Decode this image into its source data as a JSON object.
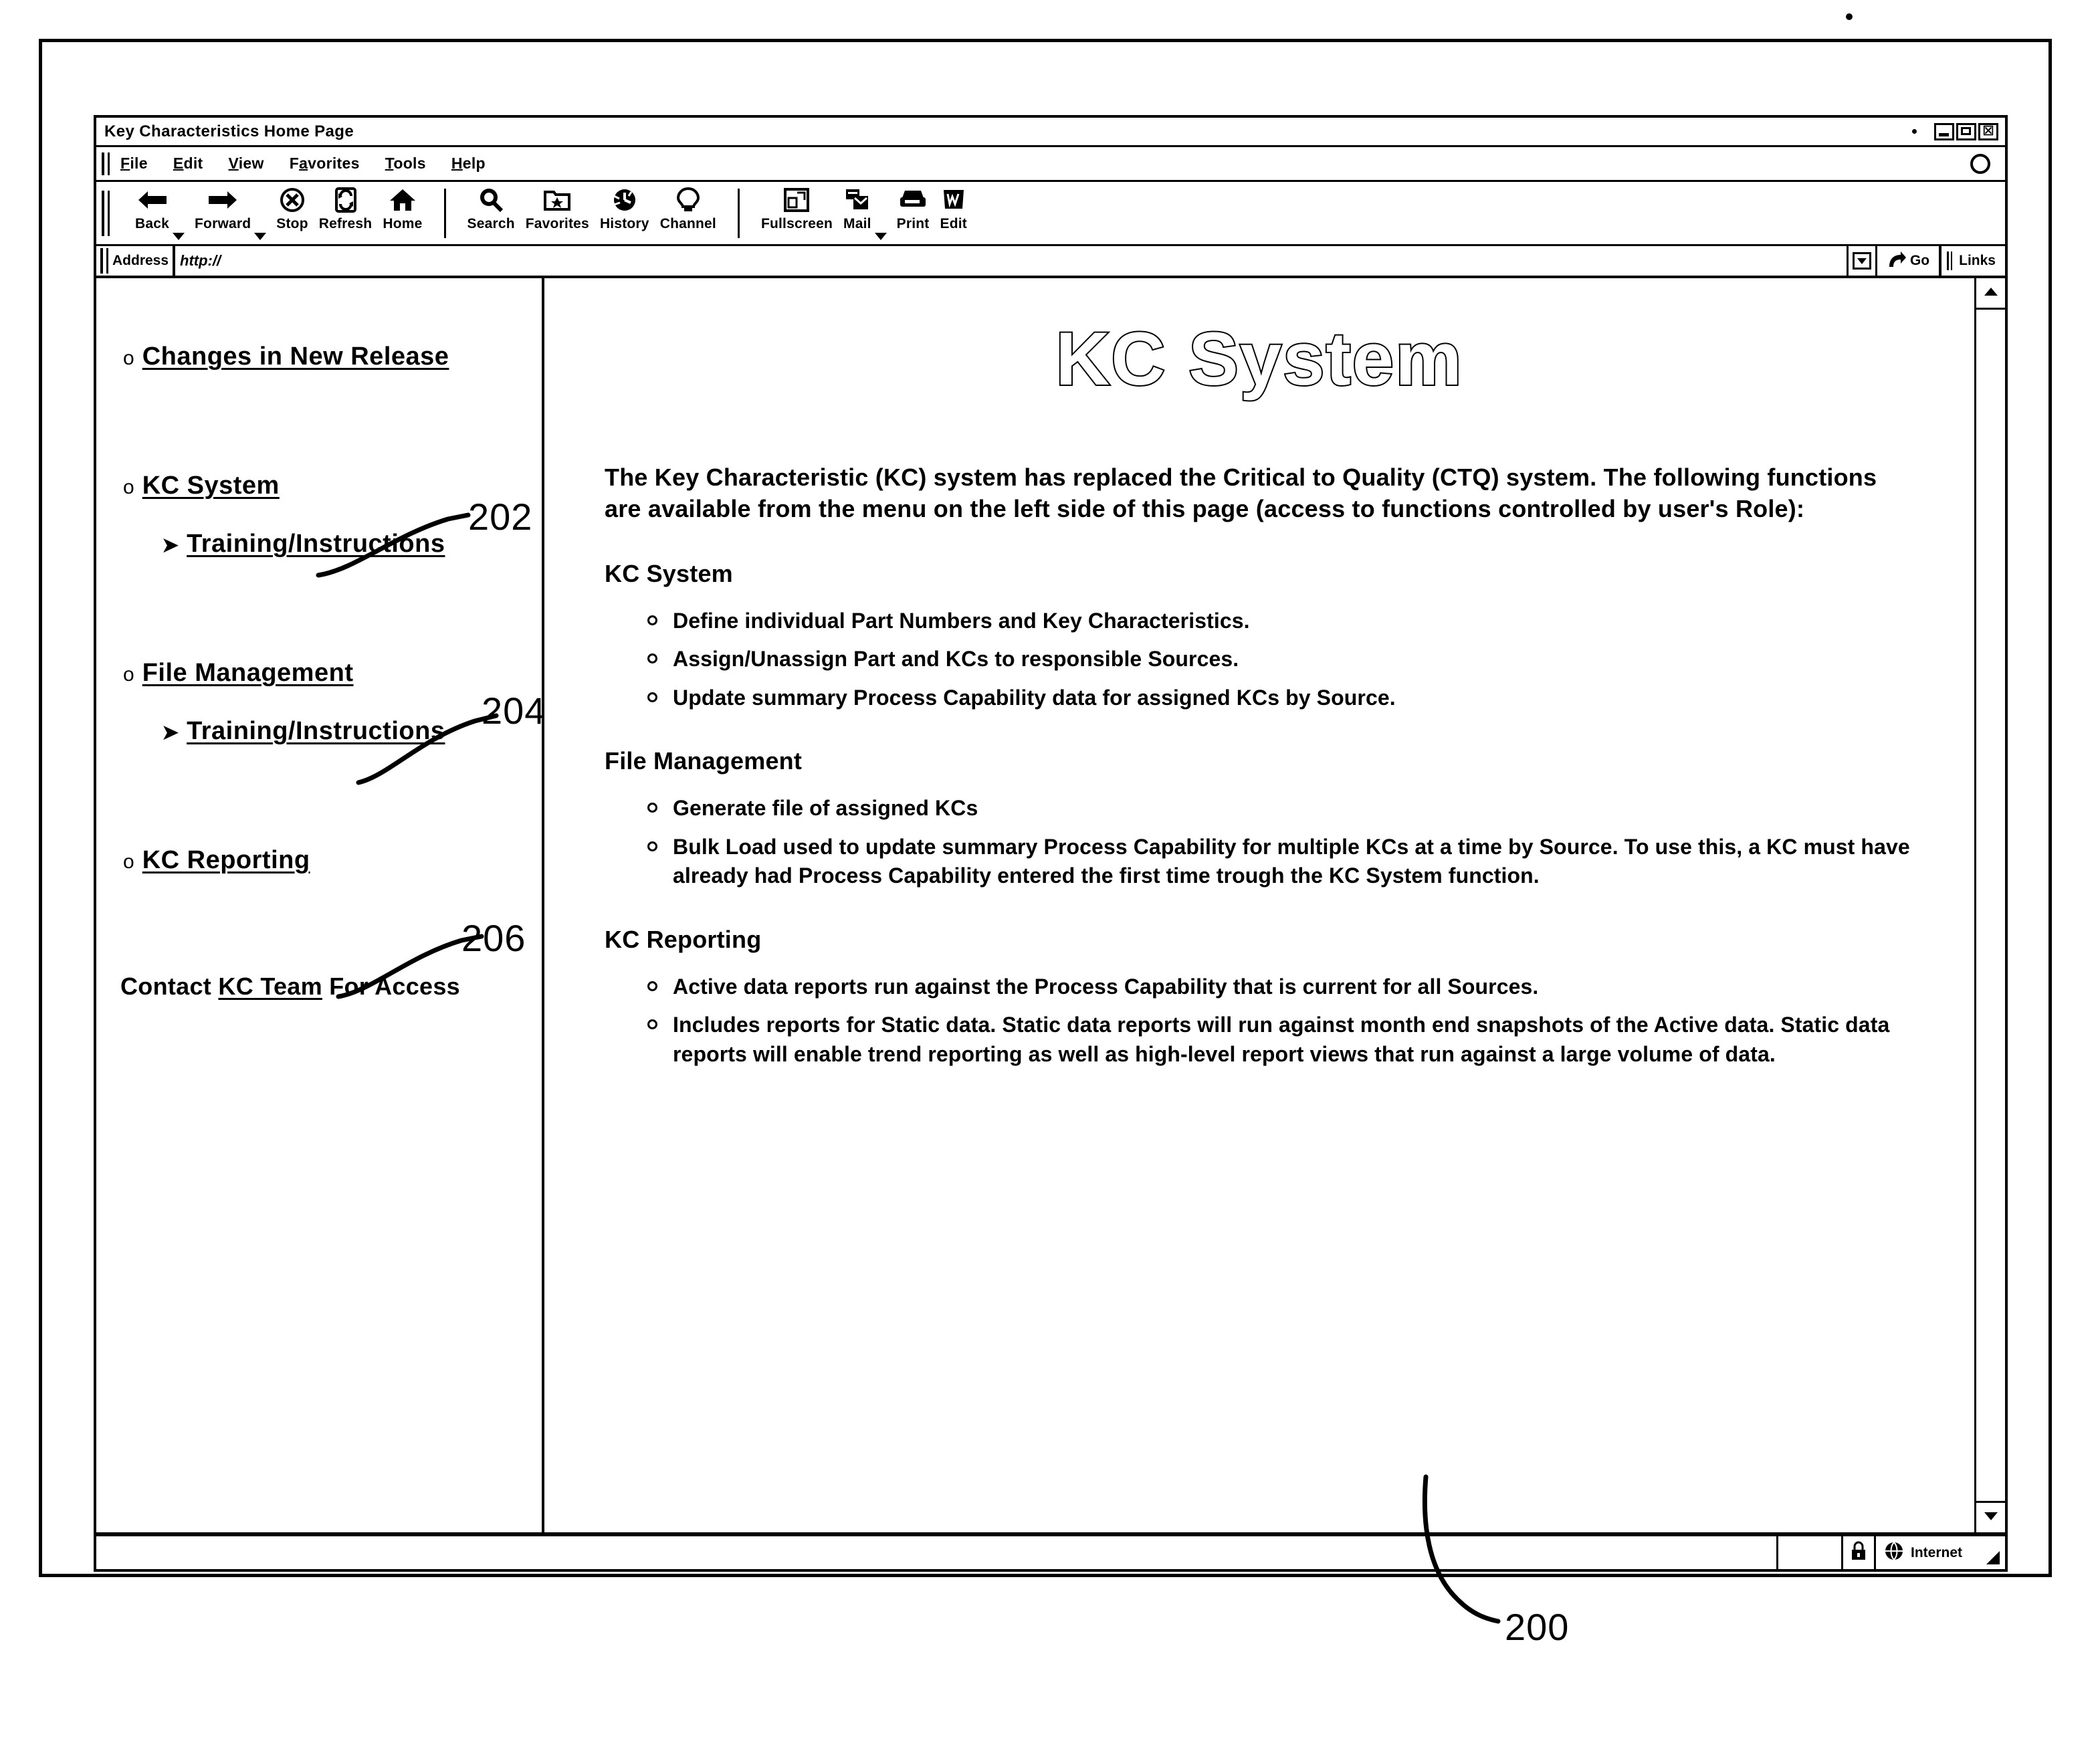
{
  "window": {
    "title": "Key Characteristics Home Page",
    "controls": {
      "minimize": "minimize",
      "maximize": "maximize",
      "close": "☒"
    }
  },
  "menu": {
    "items": [
      {
        "label": "File",
        "accel": "F"
      },
      {
        "label": "Edit",
        "accel": "E"
      },
      {
        "label": "View",
        "accel": "V"
      },
      {
        "label": "Favorites",
        "accel": "a"
      },
      {
        "label": "Tools",
        "accel": "T"
      },
      {
        "label": "Help",
        "accel": "H"
      }
    ]
  },
  "toolbar": {
    "buttons": [
      {
        "label": "Back",
        "icon": "back-arrow-icon",
        "caret": true
      },
      {
        "label": "Forward",
        "icon": "forward-arrow-icon",
        "caret": true
      },
      {
        "label": "Stop",
        "icon": "stop-x-circle-icon",
        "caret": false
      },
      {
        "label": "Refresh",
        "icon": "refresh-icon",
        "caret": false
      },
      {
        "label": "Home",
        "icon": "home-icon",
        "caret": false
      },
      {
        "label": "Search",
        "icon": "search-magnifier-icon",
        "caret": false
      },
      {
        "label": "Favorites",
        "icon": "favorites-folder-icon",
        "caret": false
      },
      {
        "label": "History",
        "icon": "history-clock-icon",
        "caret": false
      },
      {
        "label": "Channel",
        "icon": "channel-icon",
        "caret": false
      },
      {
        "label": "Fullscreen",
        "icon": "fullscreen-icon",
        "caret": false
      },
      {
        "label": "Mail",
        "icon": "mail-icon",
        "caret": true
      },
      {
        "label": "Print",
        "icon": "printer-icon",
        "caret": false
      },
      {
        "label": "Edit",
        "icon": "edit-w-icon",
        "caret": false
      }
    ]
  },
  "address": {
    "label": "Address",
    "value": "http://",
    "placeholder": "http://",
    "dropdown_icon": "chevron-down-icon",
    "go_label": "Go",
    "go_icon": "go-arrow-icon",
    "links_label": "Links"
  },
  "sidebar": {
    "items": [
      {
        "label": "Changes in New Release",
        "level": "top",
        "bullet": "o"
      },
      {
        "label": "KC System",
        "level": "top",
        "bullet": "o",
        "ref": "202"
      },
      {
        "label": "Training/Instructions",
        "level": "sub",
        "bullet": "➢"
      },
      {
        "label": "File Management",
        "level": "top",
        "bullet": "o",
        "ref": "204"
      },
      {
        "label": "Training/Instructions",
        "level": "sub",
        "bullet": "➢"
      },
      {
        "label": "KC Reporting",
        "level": "top",
        "bullet": "o",
        "ref": "206"
      }
    ],
    "contact": {
      "prefix": "Contact",
      "link": "KC Team",
      "suffix": "For Access"
    }
  },
  "page": {
    "title": "KC System",
    "intro": "The Key Characteristic (KC) system has replaced the Critical to Quality (CTQ) system. The following functions are available from the menu on the left side of this page (access to functions controlled by user's Role):",
    "sections": [
      {
        "heading": "KC System",
        "bullets": [
          "Define individual Part Numbers and Key Characteristics.",
          "Assign/Unassign Part and KCs to responsible Sources.",
          "Update summary Process Capability data for assigned KCs by Source."
        ]
      },
      {
        "heading": "File Management",
        "bullets": [
          "Generate file of assigned KCs",
          "Bulk Load used to update summary Process Capability for multiple KCs at a time by Source. To use this, a KC must have already had Process Capability entered the first time trough the KC System function."
        ]
      },
      {
        "heading": "KC Reporting",
        "bullets": [
          "Active data reports run against the Process Capability that is current for all Sources.",
          "Includes reports for Static data. Static data reports will run against month end snapshots of the Active data. Static data reports will enable trend reporting as well as high-level report views that run against a large volume of data."
        ]
      }
    ]
  },
  "status": {
    "security_icon": "lock-icon",
    "zone_icon": "globe-icon",
    "zone_label": "Internet"
  },
  "scrollbar": {
    "up_icon": "scroll-up-arrow-icon",
    "down_icon": "scroll-down-arrow-icon"
  },
  "callouts": {
    "kc_system": "202",
    "file_management": "204",
    "kc_reporting": "206",
    "browser_window": "200"
  },
  "colors": {
    "ink": "#000000",
    "paper": "#ffffff"
  }
}
